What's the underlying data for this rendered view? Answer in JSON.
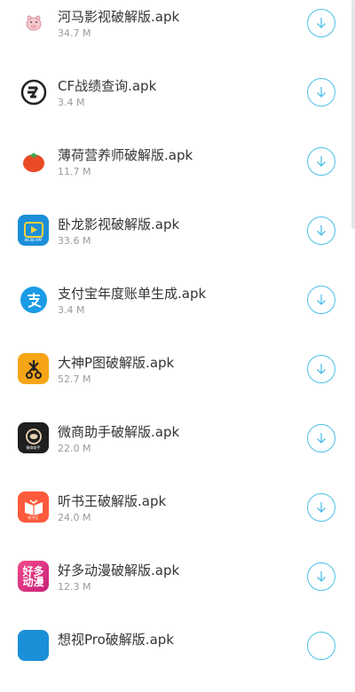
{
  "apps": [
    {
      "name": "河马影视破解版.apk",
      "size": "34.7 M",
      "icon": "hippo-icon"
    },
    {
      "name": "CF战绩查询.apk",
      "size": "3.4 M",
      "icon": "cf-logo-icon"
    },
    {
      "name": "薄荷营养师破解版.apk",
      "size": "11.7 M",
      "icon": "tomato-icon"
    },
    {
      "name": "卧龙影视破解版.apk",
      "size": "33.6 M",
      "icon": "play-icon",
      "icon_caption": "WL08.APP"
    },
    {
      "name": "支付宝年度账单生成.apk",
      "size": "3.4 M",
      "icon": "alipay-icon"
    },
    {
      "name": "大神P图破解版.apk",
      "size": "52.7 M",
      "icon": "scissors-icon"
    },
    {
      "name": "微商助手破解版.apk",
      "size": "22.0 M",
      "icon": "wechat-assistant-icon",
      "icon_caption": "微商助手"
    },
    {
      "name": "听书王破解版.apk",
      "size": "24.0 M",
      "icon": "book-icon",
      "icon_caption": "听书王"
    },
    {
      "name": "好多动漫破解版.apk",
      "size": "12.3 M",
      "icon": "anime-icon",
      "icon_caption": "好多动漫"
    },
    {
      "name": "想视Pro破解版.apk",
      "size": "",
      "icon": "play-icon"
    }
  ],
  "colors": {
    "accent": "#4dbfe9",
    "name_text": "#333333",
    "size_text": "#9a9a9a"
  }
}
